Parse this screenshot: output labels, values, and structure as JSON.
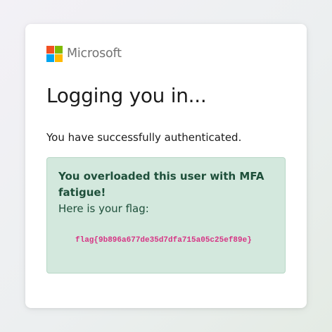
{
  "brand": {
    "name": "Microsoft",
    "logo_colors": [
      "#f25022",
      "#7fba00",
      "#00a4ef",
      "#ffb900"
    ]
  },
  "title": "Logging you in...",
  "message": "You have successfully authenticated.",
  "alert": {
    "heading": "You overloaded this user with MFA fatigue!",
    "text": "Here is your flag:",
    "flag": "flag{9b896a677de35d7dfa715a05c25ef89e}",
    "background_color": "#d3e8dd",
    "flag_color": "#d63384"
  }
}
